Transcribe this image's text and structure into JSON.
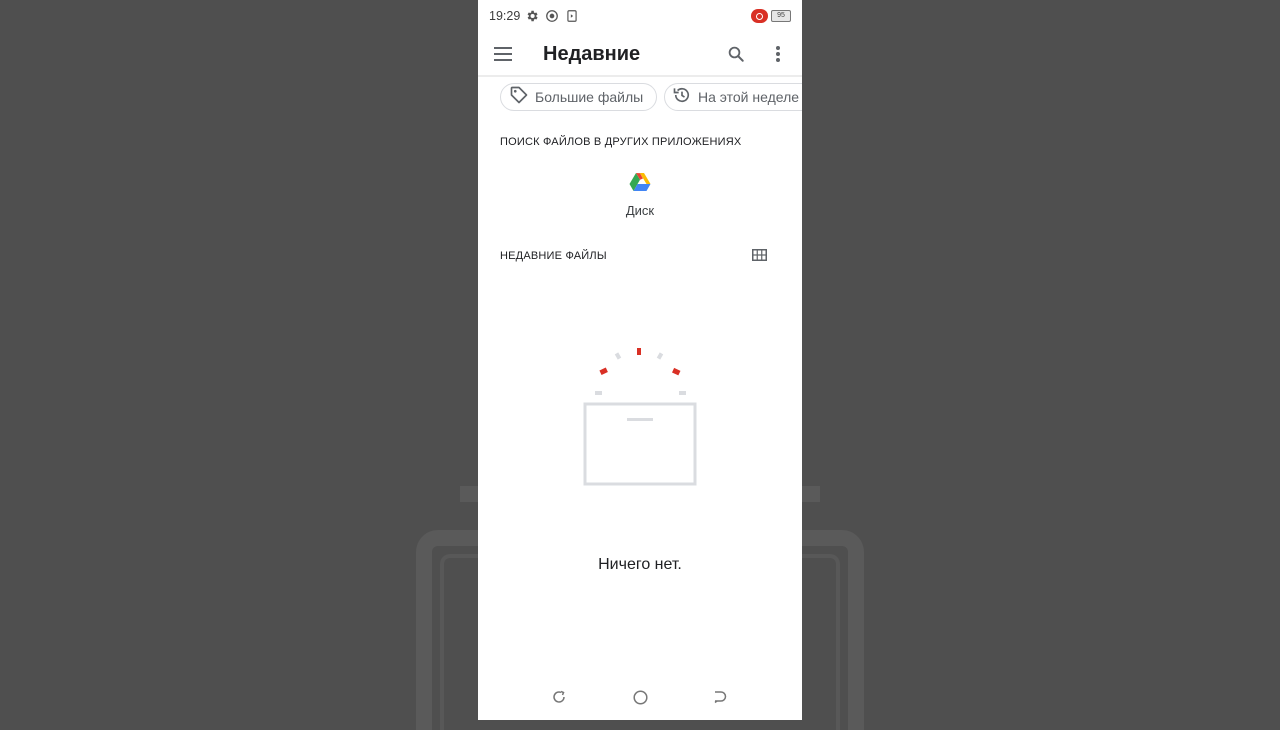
{
  "status_bar": {
    "time": "19:29",
    "battery": "95",
    "icons": [
      "settings-icon",
      "screen-record-icon",
      "sim-icon",
      "recording-badge-icon",
      "battery-icon"
    ]
  },
  "app_bar": {
    "title": "Недавние",
    "icons": [
      "menu-icon",
      "search-icon",
      "more-vert-icon"
    ]
  },
  "chips": [
    {
      "label": "Большие файлы",
      "icon": "tag-icon"
    },
    {
      "label": "На этой неделе",
      "icon": "history-icon"
    }
  ],
  "other_apps": {
    "header": "ПОИСК ФАЙЛОВ В ДРУГИХ ПРИЛОЖЕНИЯХ",
    "apps": [
      {
        "label": "Диск",
        "icon": "google-drive-icon"
      }
    ]
  },
  "recent_files": {
    "header": "НЕДАВНИЕ ФАЙЛЫ",
    "view_toggle_icon": "grid-view-icon",
    "empty_message": "Ничего нет."
  },
  "nav_bar": {
    "icons": [
      "recents-icon",
      "home-icon",
      "back-icon"
    ]
  },
  "colors": {
    "accent_red": "#d93025",
    "text_primary": "#202124",
    "text_secondary": "#5f6368",
    "backdrop": "#4f4f4f"
  }
}
